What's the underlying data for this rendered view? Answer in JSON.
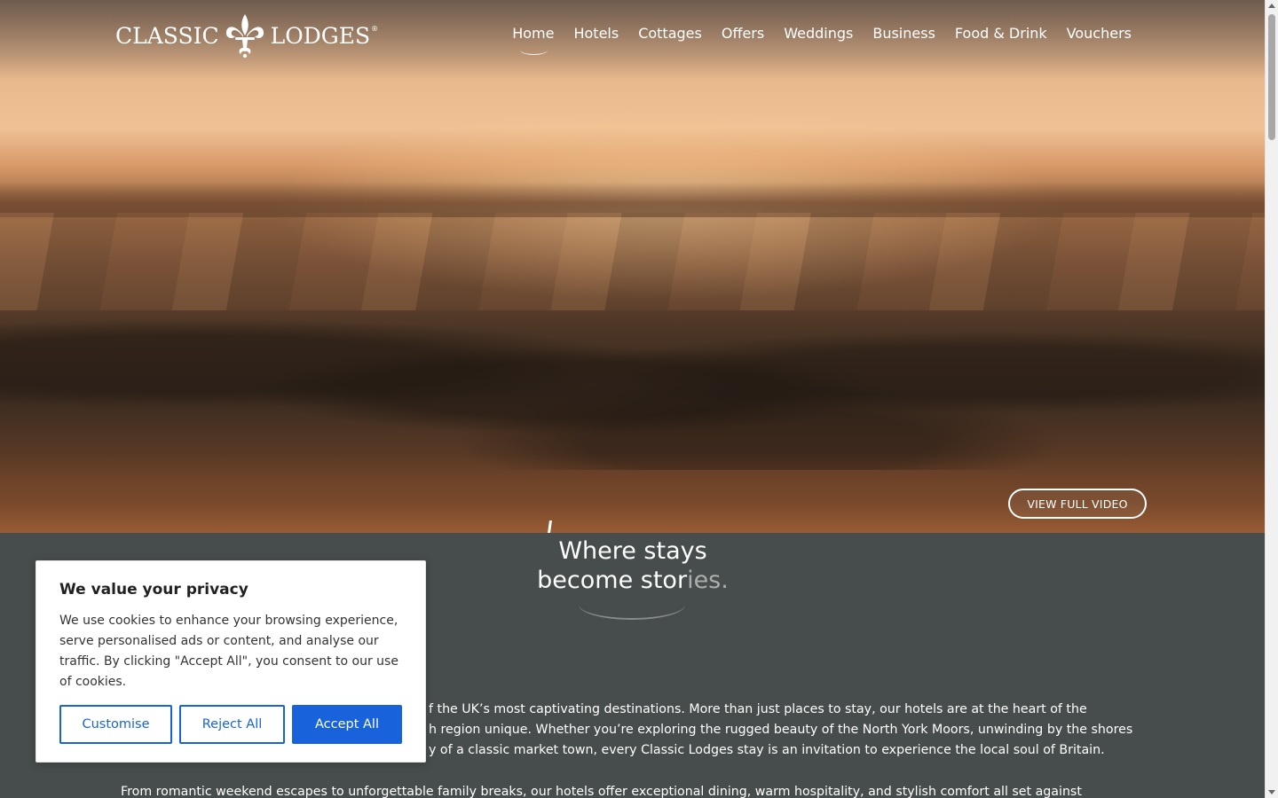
{
  "brand": {
    "name_left": "CLASSIC",
    "name_right": "LODGES",
    "registered": "®"
  },
  "nav": {
    "items": [
      {
        "label": "Home",
        "active": true
      },
      {
        "label": "Hotels"
      },
      {
        "label": "Cottages"
      },
      {
        "label": "Offers"
      },
      {
        "label": "Weddings"
      },
      {
        "label": "Business"
      },
      {
        "label": "Food & Drink"
      },
      {
        "label": "Vouchers"
      }
    ]
  },
  "hero": {
    "video_button": "VIEW FULL VIDEO"
  },
  "tagline": {
    "line1": "Where stays",
    "line2_main": "become stor",
    "line2_fade": "ies."
  },
  "intro": {
    "p1_line1": "f the UK’s most captivating destinations. More than just places to stay, our hotels are at the heart of the",
    "p1_line2": "h region unique. Whether you’re exploring the rugged beauty of the North York Moors, unwinding by the shores",
    "p1_line3": "y of a classic market town, every Classic Lodges stay is an invitation to experience the local soul of Britain.",
    "p2_line1": "From romantic weekend escapes to unforgettable family breaks, our hotels offer exceptional dining, warm hospitality, and stylish comfort all set against"
  },
  "cookie": {
    "title": "We value your privacy",
    "body": "We use cookies to enhance your browsing experience, serve personalised ads or content, and analyse our traffic. By clicking \"Accept All\", you consent to our use of cookies.",
    "customise": "Customise",
    "reject": "Reject All",
    "accept": "Accept All"
  },
  "colors": {
    "accent": "#1863dc",
    "section_bg": "#474d4c"
  }
}
